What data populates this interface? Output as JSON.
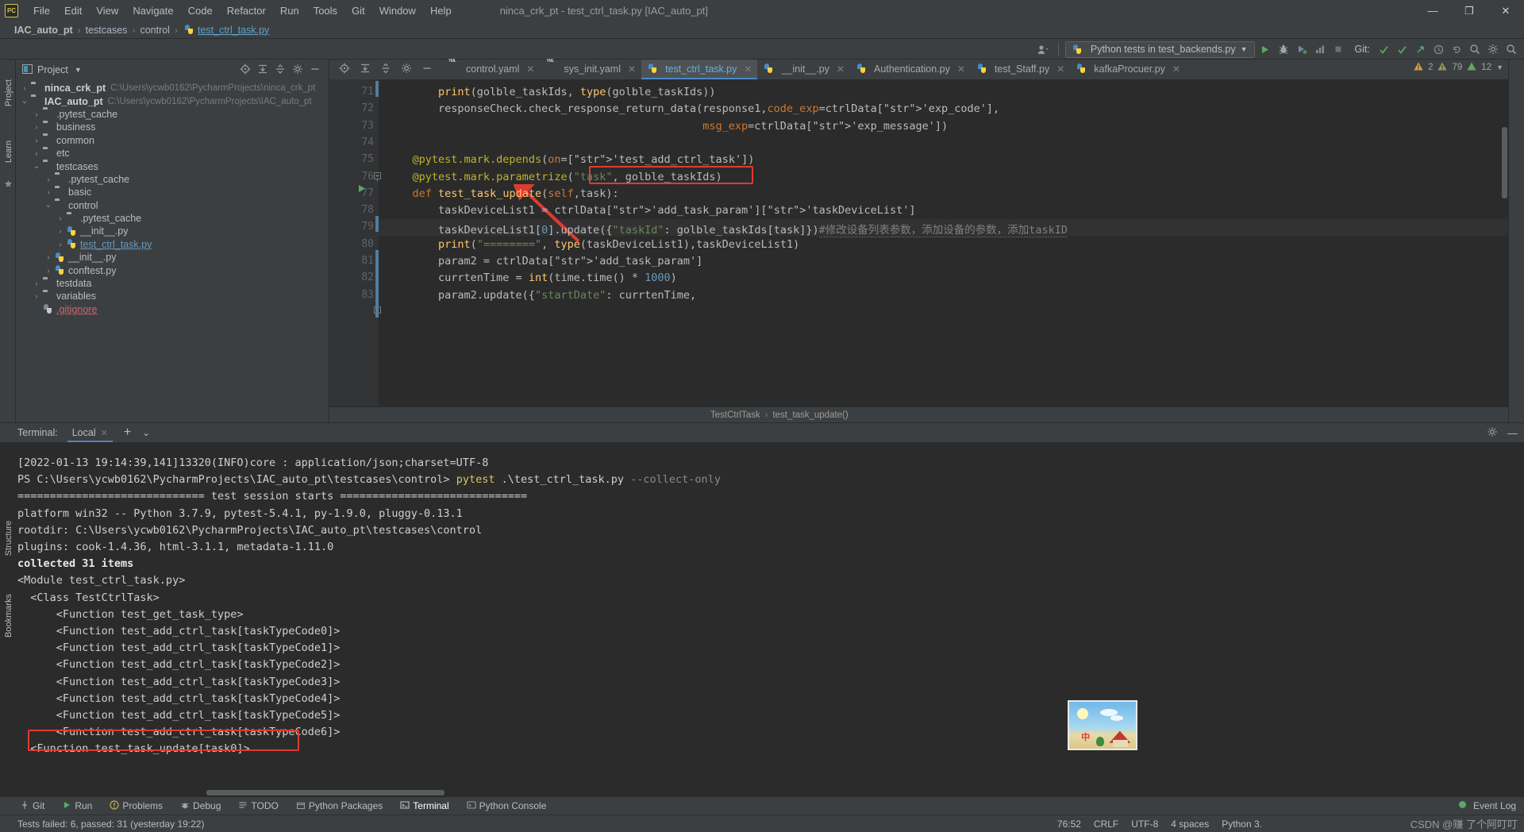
{
  "window": {
    "title": "ninca_crk_pt - test_ctrl_task.py [IAC_auto_pt]",
    "minimize": "—",
    "maximize": "❐",
    "close": "✕"
  },
  "menu": {
    "logo": "PC",
    "items": [
      "File",
      "Edit",
      "View",
      "Navigate",
      "Code",
      "Refactor",
      "Run",
      "Tools",
      "Git",
      "Window",
      "Help"
    ]
  },
  "breadcrumb": {
    "items": [
      "IAC_auto_pt",
      "testcases",
      "control",
      "test_ctrl_task.py"
    ],
    "separator": "›"
  },
  "toolbar": {
    "run_config": "Python tests in test_backends.py",
    "git_label": "Git:",
    "icons": [
      "user-icon",
      "run-icon",
      "debug-icon",
      "coverage-icon",
      "profile-icon",
      "stop-icon",
      "git-update-icon",
      "git-commit-icon",
      "git-push-icon",
      "git-history-icon",
      "search-icon",
      "settings-icon",
      "search-everywhere-icon"
    ]
  },
  "project_panel": {
    "title": "Project",
    "header_icons": [
      "locate-icon",
      "collapse-all-icon",
      "expand-icon",
      "settings-icon",
      "hide-icon"
    ],
    "tree": [
      {
        "indent": 0,
        "arrow": "›",
        "icon": "folder",
        "label": "ninca_crk_pt",
        "bold": true,
        "path": "C:\\Users\\ycwb0162\\PycharmProjects\\ninca_crk_pt"
      },
      {
        "indent": 0,
        "arrow": "⌄",
        "icon": "folder",
        "label": "IAC_auto_pt",
        "bold": true,
        "path": "C:\\Users\\ycwb0162\\PycharmProjects\\IAC_auto_pt"
      },
      {
        "indent": 1,
        "arrow": "›",
        "icon": "folder",
        "label": ".pytest_cache",
        "bold": false,
        "path": ""
      },
      {
        "indent": 1,
        "arrow": "›",
        "icon": "folder-src",
        "label": "business",
        "bold": false,
        "path": ""
      },
      {
        "indent": 1,
        "arrow": "›",
        "icon": "folder-src",
        "label": "common",
        "bold": false,
        "path": ""
      },
      {
        "indent": 1,
        "arrow": "›",
        "icon": "folder",
        "label": "etc",
        "bold": false,
        "path": ""
      },
      {
        "indent": 1,
        "arrow": "⌄",
        "icon": "folder-src",
        "label": "testcases",
        "bold": false,
        "path": ""
      },
      {
        "indent": 2,
        "arrow": "›",
        "icon": "folder",
        "label": ".pytest_cache",
        "bold": false,
        "path": ""
      },
      {
        "indent": 2,
        "arrow": "›",
        "icon": "folder-src",
        "label": "basic",
        "bold": false,
        "path": ""
      },
      {
        "indent": 2,
        "arrow": "⌄",
        "icon": "folder-src",
        "label": "control",
        "bold": false,
        "path": ""
      },
      {
        "indent": 3,
        "arrow": "›",
        "icon": "folder",
        "label": ".pytest_cache",
        "bold": false,
        "path": ""
      },
      {
        "indent": 3,
        "arrow": "›",
        "icon": "python",
        "label": "__init__.py",
        "bold": false,
        "path": ""
      },
      {
        "indent": 3,
        "arrow": "›",
        "icon": "python",
        "label": "test_ctrl_task.py",
        "bold": false,
        "color": "blue",
        "path": ""
      },
      {
        "indent": 2,
        "arrow": "›",
        "icon": "python",
        "label": "__init__.py",
        "bold": false,
        "path": ""
      },
      {
        "indent": 2,
        "arrow": "›",
        "icon": "python",
        "label": "conftest.py",
        "bold": false,
        "path": ""
      },
      {
        "indent": 1,
        "arrow": "›",
        "icon": "folder",
        "label": "testdata",
        "bold": false,
        "path": ""
      },
      {
        "indent": 1,
        "arrow": "›",
        "icon": "folder-src",
        "label": "variables",
        "bold": false,
        "path": ""
      },
      {
        "indent": 1,
        "arrow": "",
        "icon": "gitignore",
        "label": ".gitignore",
        "bold": false,
        "color": "red",
        "path": ""
      }
    ]
  },
  "editor_tabs": [
    {
      "label": "control.yaml",
      "icon": "yaml-icon",
      "active": false
    },
    {
      "label": "sys_init.yaml",
      "icon": "yaml-icon",
      "active": false
    },
    {
      "label": "test_ctrl_task.py",
      "icon": "python-icon",
      "active": true
    },
    {
      "label": "__init__.py",
      "icon": "python-icon",
      "active": false
    },
    {
      "label": "Authentication.py",
      "icon": "python-icon",
      "active": false
    },
    {
      "label": "test_Staff.py",
      "icon": "python-icon",
      "active": false
    },
    {
      "label": "kafkaProcuer.py",
      "icon": "python-icon",
      "active": false
    }
  ],
  "editor": {
    "first_line": 71,
    "lines": [
      {
        "n": 71,
        "text": "        print(golble_taskIds, type(golble_taskIds))"
      },
      {
        "n": 72,
        "text": "        responseCheck.check_response_return_data(response1,code_exp=ctrlData['exp_code'],"
      },
      {
        "n": 73,
        "text": "                                                 msg_exp=ctrlData['exp_message'])"
      },
      {
        "n": 74,
        "text": ""
      },
      {
        "n": 75,
        "text": "    @pytest.mark.depends(on=['test_add_ctrl_task'])"
      },
      {
        "n": 76,
        "text": "    @pytest.mark.parametrize(\"task\", golble_taskIds)"
      },
      {
        "n": 77,
        "text": "    def test_task_update(self,task):"
      },
      {
        "n": 78,
        "text": "        taskDeviceList1 = ctrlData['add_task_param']['taskDeviceList']"
      },
      {
        "n": 79,
        "text": "        taskDeviceList1[0].update({\"taskId\": golble_taskIds[task]})#修改设备列表参数，添加设备的参数，添加taskID"
      },
      {
        "n": 80,
        "text": "        print(\"========\", type(taskDeviceList1),taskDeviceList1)"
      },
      {
        "n": 81,
        "text": "        param2 = ctrlData['add_task_param']"
      },
      {
        "n": 82,
        "text": "        currtenTime = int(time.time() * 1000)"
      },
      {
        "n": 83,
        "text": "        param2.update({\"startDate\": currtenTime,"
      }
    ],
    "breadcrumb_class": "TestCtrlTask",
    "breadcrumb_method": "test_task_update()",
    "breadcrumb_sep": "›",
    "inspections": {
      "warnings": "2",
      "weak_warnings": "79",
      "typos": "12"
    }
  },
  "terminal": {
    "label": "Terminal:",
    "tab": "Local",
    "add_icon": "+",
    "chevron_icon": "⌄",
    "settings_icon": "gear-icon",
    "hide_icon": "—",
    "lines": [
      {
        "text": "[2022-01-13 19:14:39,141]13320(INFO)core : application/json;charset=UTF-8",
        "style": "plain"
      },
      {
        "text": "PS C:\\Users\\ycwb0162\\PycharmProjects\\IAC_auto_pt\\testcases\\control> ",
        "style": "prompt",
        "cmd": "pytest",
        "args": " .\\test_ctrl_task.py ",
        "flag": "--collect-only"
      },
      {
        "text": "============================= test session starts =============================",
        "style": "sep"
      },
      {
        "text": "platform win32 -- Python 3.7.9, pytest-5.4.1, py-1.9.0, pluggy-0.13.1",
        "style": "plain"
      },
      {
        "text": "rootdir: C:\\Users\\ycwb0162\\PycharmProjects\\IAC_auto_pt\\testcases\\control",
        "style": "plain"
      },
      {
        "text": "plugins: cook-1.4.36, html-3.1.1, metadata-1.11.0",
        "style": "plain"
      },
      {
        "text": "collected 31 items",
        "style": "bold"
      },
      {
        "text": "<Module test_ctrl_task.py>",
        "style": "plain"
      },
      {
        "text": "  <Class TestCtrlTask>",
        "style": "plain"
      },
      {
        "text": "      <Function test_get_task_type>",
        "style": "plain"
      },
      {
        "text": "      <Function test_add_ctrl_task[taskTypeCode0]>",
        "style": "plain"
      },
      {
        "text": "      <Function test_add_ctrl_task[taskTypeCode1]>",
        "style": "plain"
      },
      {
        "text": "      <Function test_add_ctrl_task[taskTypeCode2]>",
        "style": "plain"
      },
      {
        "text": "      <Function test_add_ctrl_task[taskTypeCode3]>",
        "style": "plain"
      },
      {
        "text": "      <Function test_add_ctrl_task[taskTypeCode4]>",
        "style": "plain"
      },
      {
        "text": "      <Function test_add_ctrl_task[taskTypeCode5]>",
        "style": "plain"
      },
      {
        "text": "      <Function test_add_ctrl_task[taskTypeCode6]>",
        "style": "plain"
      },
      {
        "text": "  <Function test_task_update[task0]>",
        "style": "plain"
      }
    ]
  },
  "bottom_bar": {
    "items": [
      {
        "label": "Git",
        "icon": "git-icon",
        "active": false
      },
      {
        "label": "Run",
        "icon": "run-icon",
        "active": false
      },
      {
        "label": "Problems",
        "icon": "problems-icon",
        "active": false
      },
      {
        "label": "Debug",
        "icon": "debug-icon",
        "active": false
      },
      {
        "label": "TODO",
        "icon": "todo-icon",
        "active": false
      },
      {
        "label": "Python Packages",
        "icon": "package-icon",
        "active": false
      },
      {
        "label": "Terminal",
        "icon": "terminal-icon",
        "active": true
      },
      {
        "label": "Python Console",
        "icon": "console-icon",
        "active": false
      }
    ],
    "event_log": "Event Log"
  },
  "status_bar": {
    "tests_summary": "Tests failed: 6, passed: 31 (yesterday 19:22)",
    "caret": "76:52",
    "line_sep": "CRLF",
    "encoding": "UTF-8",
    "indent": "4 spaces",
    "interpreter": "Python 3.",
    "watermark": "CSDN @赚 了个阿叮叮"
  },
  "left_rail": {
    "labels": [
      "Project",
      "Learn"
    ]
  },
  "right_rail_bottom": {
    "labels": [
      "Structure",
      "Bookmarks"
    ]
  },
  "colors": {
    "accent": "#4a88c7",
    "highlight_box": "#e03b2f",
    "bg": "#3c3f41",
    "editor_bg": "#2b2b2b"
  }
}
